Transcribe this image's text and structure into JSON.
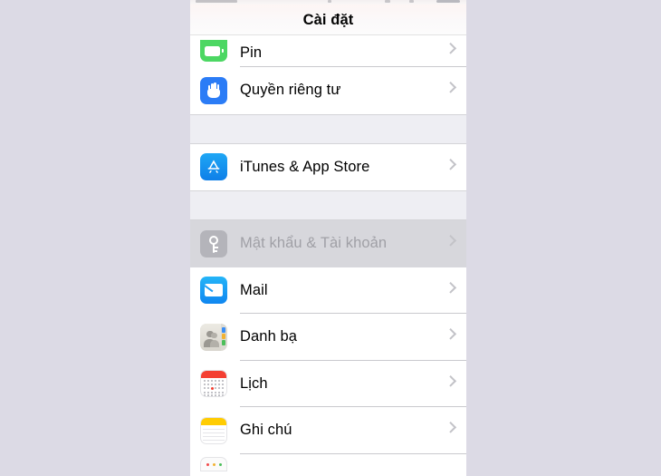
{
  "device": {
    "background_color": "#dcdae5",
    "screen_background": "#ffffff"
  },
  "statusbar": {
    "visible": true,
    "note": "partially cut off at top edge"
  },
  "navbar": {
    "title": "Cài đặt",
    "title_color": "#050505"
  },
  "sections": [
    {
      "id": "section-1",
      "rows": [
        {
          "label": "Pin",
          "icon": "battery-icon",
          "icon_color": "#4cd763",
          "clipped": "top",
          "state": "normal",
          "chevron": true
        },
        {
          "label": "Quyền riêng tư",
          "icon": "hand-privacy-icon",
          "icon_color": "#2b7cf6",
          "clipped": "none",
          "state": "normal",
          "chevron": true
        }
      ]
    },
    {
      "id": "section-2",
      "rows": [
        {
          "label": "iTunes & App Store",
          "icon": "app-store-icon",
          "icon_color": "#0e7fe8",
          "clipped": "none",
          "state": "normal",
          "chevron": true
        }
      ]
    },
    {
      "id": "section-3",
      "rows": [
        {
          "label": "Mật khẩu & Tài khoản",
          "icon": "key-icon",
          "icon_color": "#b4b4ba",
          "clipped": "none",
          "state": "pressed",
          "chevron": true
        },
        {
          "label": "Mail",
          "icon": "mail-envelope-icon",
          "icon_color": "#0f86f0",
          "clipped": "none",
          "state": "normal",
          "chevron": true
        },
        {
          "label": "Danh bạ",
          "icon": "contacts-icon",
          "icon_color": "#dcdad3",
          "clipped": "none",
          "state": "normal",
          "chevron": true
        },
        {
          "label": "Lịch",
          "icon": "calendar-icon",
          "icon_color": "#f43f32",
          "clipped": "none",
          "state": "normal",
          "chevron": true
        },
        {
          "label": "Ghi chú",
          "icon": "notes-icon",
          "icon_color": "#ffcc02",
          "clipped": "none",
          "state": "normal",
          "chevron": true
        },
        {
          "label": "",
          "icon": "reminders-icon",
          "icon_color": "#fbfbfb",
          "clipped": "bottom",
          "state": "normal",
          "chevron": false
        }
      ]
    }
  ],
  "colors": {
    "section_gap": "#eeeef3",
    "separator": "#c9c9ce",
    "chevron": "#c3c3c8",
    "pressed_row": "#d7d7dc",
    "pressed_text": "#a0a0a6"
  }
}
